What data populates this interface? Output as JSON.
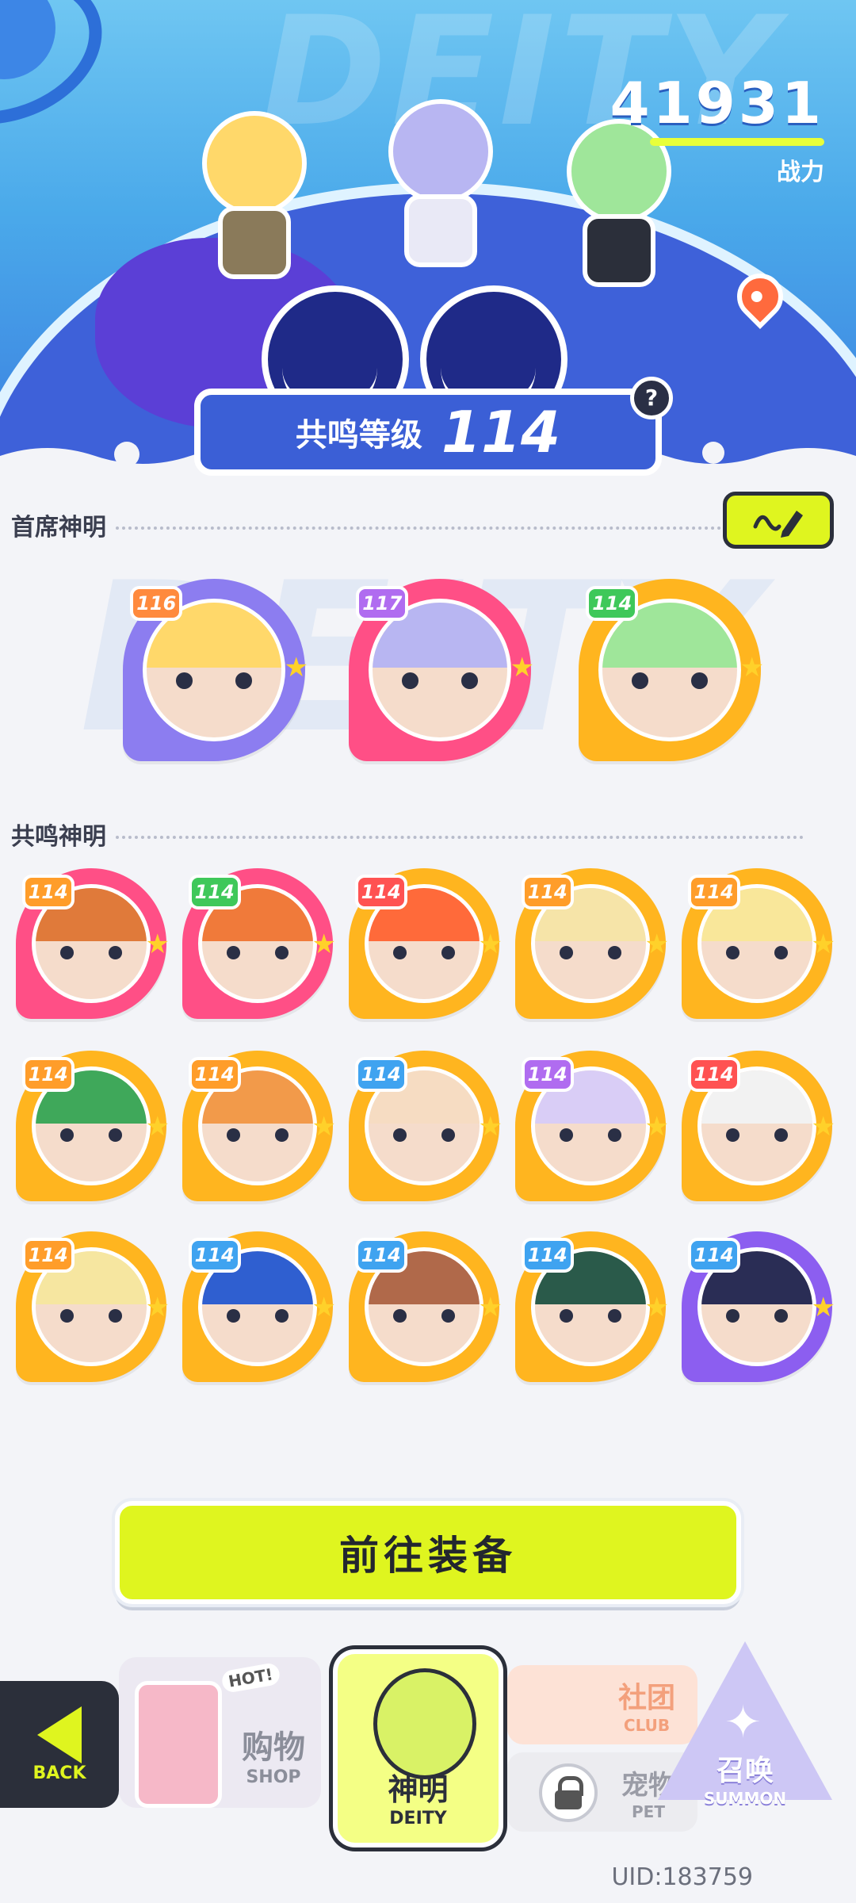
{
  "header": {
    "power_value": "41931",
    "power_label": "战力",
    "resonance_label": "共鸣等级",
    "resonance_value": "114",
    "help_glyph": "?",
    "bg_word": "DEITY"
  },
  "chief_section": {
    "title": "首席神明",
    "cards": [
      {
        "level": "116",
        "badge_color": "#ff8a3d",
        "ring": "#8c7df0",
        "hair": "#ffd86a"
      },
      {
        "level": "117",
        "badge_color": "#b06cf0",
        "ring": "#ff4f86",
        "hair": "#b8b6f2"
      },
      {
        "level": "114",
        "badge_color": "#3fc85a",
        "ring": "#ffb51f",
        "hair": "#9fe69a"
      }
    ]
  },
  "resonance_section": {
    "title": "共鸣神明",
    "cards": [
      {
        "level": "114",
        "badge_color": "#ff9d2a",
        "ring": "#ff4f86",
        "hair": "#e07a3a"
      },
      {
        "level": "114",
        "badge_color": "#3fc85a",
        "ring": "#ff4f86",
        "hair": "#f07a3a"
      },
      {
        "level": "114",
        "badge_color": "#ff5252",
        "ring": "#ffb51f",
        "hair": "#ff6a3a"
      },
      {
        "level": "114",
        "badge_color": "#ff9d2a",
        "ring": "#ffb51f",
        "hair": "#f6e4a8"
      },
      {
        "level": "114",
        "badge_color": "#ff9d2a",
        "ring": "#ffb51f",
        "hair": "#f9e79a"
      },
      {
        "level": "114",
        "badge_color": "#ff9d2a",
        "ring": "#ffb51f",
        "hair": "#3fa85a"
      },
      {
        "level": "114",
        "badge_color": "#ff9d2a",
        "ring": "#ffb51f",
        "hair": "#f29a4a"
      },
      {
        "level": "114",
        "badge_color": "#3fa3f0",
        "ring": "#ffb51f",
        "hair": "#f6dcc2"
      },
      {
        "level": "114",
        "badge_color": "#b06cf0",
        "ring": "#ffb51f",
        "hair": "#d9cdf6"
      },
      {
        "level": "114",
        "badge_color": "#ff5252",
        "ring": "#ffb51f",
        "hair": "#f2f2f2"
      },
      {
        "level": "114",
        "badge_color": "#ff9d2a",
        "ring": "#ffb51f",
        "hair": "#f6e6a0"
      },
      {
        "level": "114",
        "badge_color": "#3fa3f0",
        "ring": "#ffb51f",
        "hair": "#2f5fd0"
      },
      {
        "level": "114",
        "badge_color": "#3fa3f0",
        "ring": "#ffb51f",
        "hair": "#b0694a"
      },
      {
        "level": "114",
        "badge_color": "#3fa3f0",
        "ring": "#ffb51f",
        "hair": "#2a5a4a"
      },
      {
        "level": "114",
        "badge_color": "#3fa3f0",
        "ring": "#8c5ef0",
        "hair": "#2a2d55"
      }
    ]
  },
  "equip_button": "前往装备",
  "nav": {
    "back_label": "BACK",
    "shop_hot": "HOT!",
    "shop_zh": "购物",
    "shop_en": "SHOP",
    "deity_zh": "神明",
    "deity_en": "DEITY",
    "club_zh": "社团",
    "club_en": "CLUB",
    "pet_zh": "宠物",
    "pet_en": "PET",
    "summon_zh": "召唤",
    "summon_en": "SUMMON"
  },
  "uid": "UID:183759",
  "colors": {
    "accent": "#dff51f",
    "header_blue": "#3b5fd6"
  }
}
